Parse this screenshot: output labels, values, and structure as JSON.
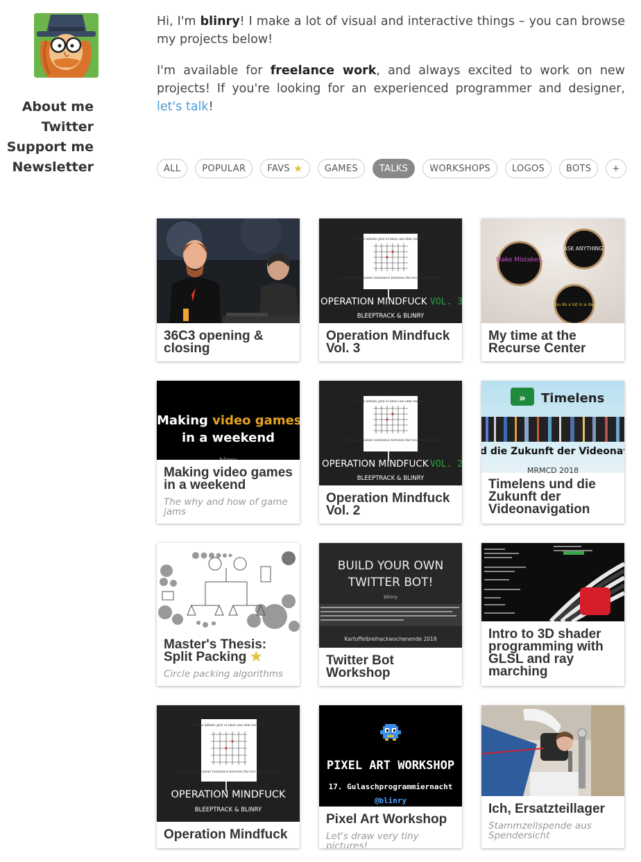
{
  "nav": {
    "items": [
      {
        "label": "About me"
      },
      {
        "label": "Twitter"
      },
      {
        "label": "Support me"
      },
      {
        "label": "Newsletter"
      }
    ]
  },
  "intro": {
    "p1_pre": "Hi, I'm ",
    "p1_name": "blinry",
    "p1_post": "! I make a lot of visual and interactive things – you can browse my projects below!",
    "p2_pre": "I'm available for ",
    "p2_bold": "freelance work",
    "p2_mid": ", and always excited to work on new projects! If you're looking for an experienced programmer and designer, ",
    "p2_link": "let's talk",
    "p2_post": "!"
  },
  "filters": {
    "all": "ALL",
    "popular": "POPULAR",
    "favs": "FAVS",
    "games": "GAMES",
    "talks": "TALKS",
    "workshops": "WORKSHOPS",
    "logos": "LOGOS",
    "bots": "BOTS",
    "more": "+",
    "active": "TALKS"
  },
  "projects": [
    {
      "title": "36C3 opening & closing",
      "subtitle": ""
    },
    {
      "title": "Operation Mindfuck Vol. 3",
      "subtitle": "",
      "thumb_title": "OPERATION MINDFUCK",
      "thumb_vol": "VOL. 3",
      "thumb_authors": "BLEEPTRACK & BLINRY"
    },
    {
      "title": "My time at the Recurse Center",
      "subtitle": "",
      "hoop1": "Make Mistakes.",
      "hoop2": "ASK ANYTHING.",
      "hoop3": "You do a lot in a day"
    },
    {
      "title": "Making video games in a weekend",
      "subtitle": "The why and how of game jams",
      "thumb_line1a": "Making ",
      "thumb_line1b": "video games",
      "thumb_line2": "in a weekend",
      "thumb_small": "blinry"
    },
    {
      "title": "Operation Mindfuck Vol. 2",
      "subtitle": "",
      "thumb_title": "OPERATION MINDFUCK",
      "thumb_vol": "VOL. 2",
      "thumb_authors": "BLEEPTRACK & BLINRY"
    },
    {
      "title": "Timelens und die Zukunft der Videonavigation",
      "subtitle": "",
      "thumb_brand": "Timelens",
      "thumb_caption": "d die Zukunft der Videonavigati",
      "thumb_small": "MRMCD 2018"
    },
    {
      "title": "Master's Thesis: Split Packing",
      "subtitle": "Circle packing algorithms"
    },
    {
      "title": "Twitter Bot Workshop",
      "subtitle": "",
      "thumb_line1": "BUILD YOUR OWN",
      "thumb_line2": "TWITTER BOT!",
      "thumb_author": "blinry",
      "thumb_event": "Kartoffelbreihackwochenende 2018"
    },
    {
      "title": "Intro to 3D shader programming with GLSL and ray marching",
      "subtitle": ""
    },
    {
      "title": "Operation Mindfuck",
      "subtitle": "",
      "thumb_title": "OPERATION MINDFUCK",
      "thumb_authors": "BLEEPTRACK & BLINRY"
    },
    {
      "title": "Pixel Art Workshop",
      "subtitle": "Let's draw very tiny pictures!",
      "thumb_line1": "PIXEL ART WORKSHOP",
      "thumb_line2": "17. Gulaschprogrammiernacht",
      "thumb_handle": "@blinry"
    },
    {
      "title": "Ich, Ersatzteillager",
      "subtitle": "Stammzellspende aus Spendersicht"
    }
  ],
  "riddle": {
    "top": "On this infinite grid of ideal one-ohm resistors,",
    "bottom": "what's the equivalent resistance between the two marked nodes?"
  }
}
